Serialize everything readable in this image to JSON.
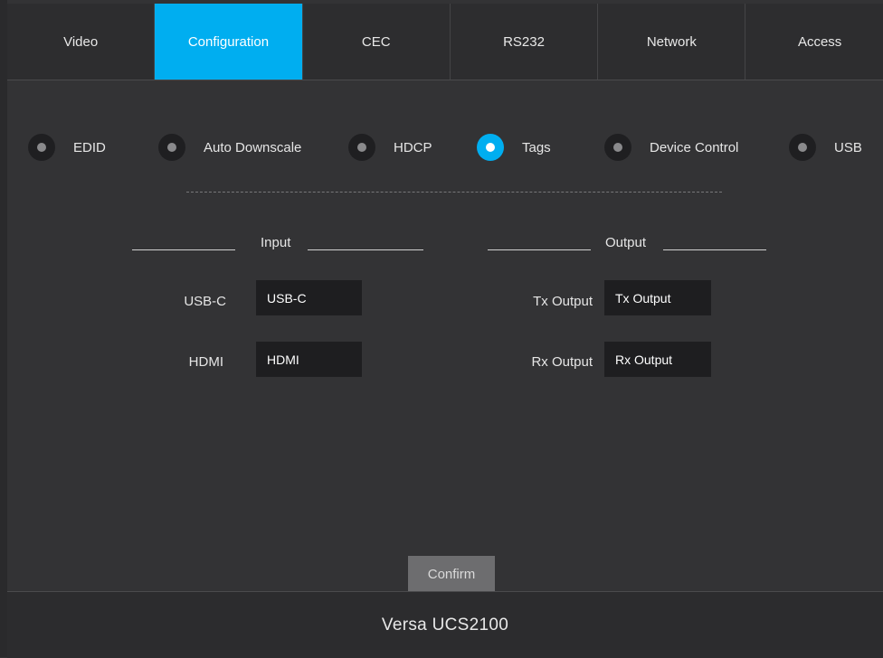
{
  "tabs": [
    {
      "label": "Video"
    },
    {
      "label": "Configuration"
    },
    {
      "label": "CEC"
    },
    {
      "label": "RS232"
    },
    {
      "label": "Network"
    },
    {
      "label": "Access"
    }
  ],
  "active_tab": "Configuration",
  "options": [
    {
      "label": "EDID"
    },
    {
      "label": "Auto Downscale"
    },
    {
      "label": "HDCP"
    },
    {
      "label": "Tags"
    },
    {
      "label": "Device Control"
    },
    {
      "label": "USB"
    }
  ],
  "selected_option": "Tags",
  "input_section": {
    "title": "Input",
    "fields": [
      {
        "label": "USB-C",
        "value": "USB-C"
      },
      {
        "label": "HDMI",
        "value": "HDMI"
      }
    ]
  },
  "output_section": {
    "title": "Output",
    "fields": [
      {
        "label": "Tx Output",
        "value": "Tx Output"
      },
      {
        "label": "Rx Output",
        "value": "Rx Output"
      }
    ]
  },
  "confirm_label": "Confirm",
  "footer_title": "Versa UCS2100",
  "colors": {
    "accent": "#00aef0",
    "background": "#333335",
    "field_bg": "#1e1e20"
  }
}
